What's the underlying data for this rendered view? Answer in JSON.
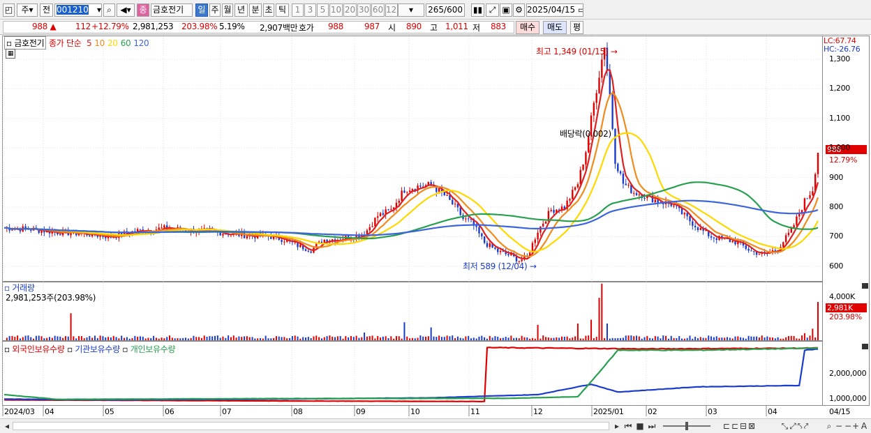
{
  "toolbar": {
    "kind": "주",
    "prev": "전",
    "code": "001210",
    "name": "금호전기",
    "periods": [
      "일",
      "주",
      "월",
      "년",
      "분",
      "초",
      "틱"
    ],
    "intervals": [
      "1",
      "3",
      "5",
      "10",
      "20",
      "30",
      "60",
      "120"
    ],
    "count": "265",
    "count_max": "/600",
    "date": "2025/04/15"
  },
  "quote": {
    "price": "988",
    "change": "112",
    "change_pct": "+12.79%",
    "volume": "2,981,253",
    "vol_ratio": "203.98%",
    "turnover_pct": "5.19%",
    "amount": "2,907백만",
    "hoga_label": "호가",
    "ask": "988",
    "bid": "987",
    "open_label": "시",
    "open": "890",
    "high_label": "고",
    "high": "1,011",
    "low_label": "저",
    "low": "883",
    "buy_label": "매수",
    "sell_label": "매도",
    "flat_label": "평"
  },
  "price_panel": {
    "stock_label": "금호전기",
    "ma_prefix": "종가 단순",
    "ma_periods": [
      "5",
      "10",
      "20",
      "60",
      "120"
    ],
    "ma_colors": [
      "#e02020",
      "#f08c1e",
      "#ffd800",
      "#28a050",
      "#3c64dc"
    ],
    "lc": "LC:67.74",
    "hc": "HC:-26.76",
    "high_annotation": "최고 1,349 (01/15)",
    "low_annotation": "최저 589 (12/04)",
    "dividend_annotation": "배당락(0.002)",
    "price_ticks": [
      "1,300",
      "1,200",
      "1,100",
      "1,000",
      "900",
      "800",
      "700",
      "600"
    ],
    "current_price": "988",
    "current_pct": "12.79%"
  },
  "volume_panel": {
    "title": "거래량",
    "subtitle": "2,981,253주(203.98%)",
    "ticks": [
      "4,000K"
    ],
    "current": "2,981K",
    "current_pct": "203.98%"
  },
  "holding_panel": {
    "legend": [
      "외국인보유수량",
      "기관보유수량",
      "개인보유수량"
    ],
    "legend_colors": [
      "#e00000",
      "#1a3ccc",
      "#28a050"
    ],
    "ticks": [
      "2,000,000",
      "1,000,000"
    ]
  },
  "x_axis": {
    "labels": [
      "2024/03",
      "04",
      "05",
      "06",
      "07",
      "08",
      "09",
      "10",
      "11",
      "12",
      "2025/01",
      "02",
      "03",
      "04"
    ],
    "right_label": "04/15"
  },
  "chart_data": {
    "type": "candlestick",
    "months": [
      "2024/03",
      "04",
      "05",
      "06",
      "07",
      "08",
      "09",
      "10",
      "11",
      "12",
      "2025/01",
      "02",
      "03",
      "04"
    ],
    "price_ylim": [
      550,
      1380
    ],
    "close_series": [
      [
        0,
        730
      ],
      [
        10,
        725
      ],
      [
        20,
        715
      ],
      [
        30,
        710
      ],
      [
        40,
        700
      ],
      [
        50,
        720
      ],
      [
        60,
        728
      ],
      [
        70,
        722
      ],
      [
        80,
        715
      ],
      [
        90,
        705
      ],
      [
        100,
        700
      ],
      [
        105,
        690
      ],
      [
        110,
        670
      ],
      [
        115,
        655
      ],
      [
        120,
        690
      ],
      [
        125,
        692
      ],
      [
        130,
        700
      ],
      [
        135,
        710
      ],
      [
        140,
        770
      ],
      [
        145,
        790
      ],
      [
        150,
        860
      ],
      [
        155,
        870
      ],
      [
        160,
        875
      ],
      [
        165,
        840
      ],
      [
        170,
        790
      ],
      [
        172,
        760
      ],
      [
        175,
        750
      ],
      [
        180,
        680
      ],
      [
        185,
        650
      ],
      [
        190,
        635
      ],
      [
        193,
        620
      ],
      [
        196,
        630
      ],
      [
        200,
        720
      ],
      [
        205,
        790
      ],
      [
        210,
        800
      ],
      [
        215,
        880
      ],
      [
        218,
        990
      ],
      [
        221,
        1150
      ],
      [
        223,
        1250
      ],
      [
        225,
        1349
      ],
      [
        227,
        1180
      ],
      [
        229,
        960
      ],
      [
        232,
        880
      ],
      [
        236,
        850
      ],
      [
        240,
        840
      ],
      [
        245,
        820
      ],
      [
        250,
        810
      ],
      [
        255,
        770
      ],
      [
        260,
        730
      ],
      [
        265,
        700
      ],
      [
        270,
        690
      ],
      [
        275,
        680
      ],
      [
        280,
        650
      ],
      [
        285,
        640
      ],
      [
        290,
        660
      ],
      [
        295,
        720
      ],
      [
        300,
        820
      ],
      [
        303,
        860
      ],
      [
        305,
        988
      ]
    ],
    "annotations": {
      "high": {
        "value": 1349,
        "date": "01/15"
      },
      "low": {
        "value": 589,
        "date": "12/04"
      }
    },
    "volume_ylim": [
      0,
      4500
    ],
    "volume_spikes": [
      [
        25,
        2100
      ],
      [
        135,
        600
      ],
      [
        150,
        1400
      ],
      [
        160,
        1000
      ],
      [
        200,
        1200
      ],
      [
        215,
        1300
      ],
      [
        220,
        1600
      ],
      [
        223,
        3300
      ],
      [
        224,
        4400
      ],
      [
        226,
        1300
      ],
      [
        300,
        550
      ],
      [
        303,
        900
      ],
      [
        305,
        2981
      ]
    ],
    "holding_ylim": [
      600000,
      3000000
    ],
    "holding_series": [
      {
        "name": "외국인보유수량",
        "points": [
          [
            0,
            800000
          ],
          [
            100,
            760000
          ],
          [
            180,
            740000
          ],
          [
            181,
            2800000
          ],
          [
            240,
            2750000
          ],
          [
            305,
            2780000
          ]
        ]
      },
      {
        "name": "기관보유수량",
        "points": [
          [
            0,
            830000
          ],
          [
            40,
            800000
          ],
          [
            90,
            820000
          ],
          [
            160,
            880000
          ],
          [
            200,
            1000000
          ],
          [
            220,
            1400000
          ],
          [
            230,
            1100000
          ],
          [
            260,
            1300000
          ],
          [
            298,
            1350000
          ],
          [
            300,
            2700000
          ],
          [
            305,
            2750000
          ]
        ]
      },
      {
        "name": "개인보유수량",
        "points": [
          [
            0,
            1000000
          ],
          [
            20,
            820000
          ],
          [
            100,
            850000
          ],
          [
            190,
            860000
          ],
          [
            215,
            920000
          ],
          [
            220,
            1500000
          ],
          [
            230,
            2700000
          ],
          [
            260,
            2700000
          ],
          [
            305,
            2780000
          ]
        ]
      }
    ]
  }
}
